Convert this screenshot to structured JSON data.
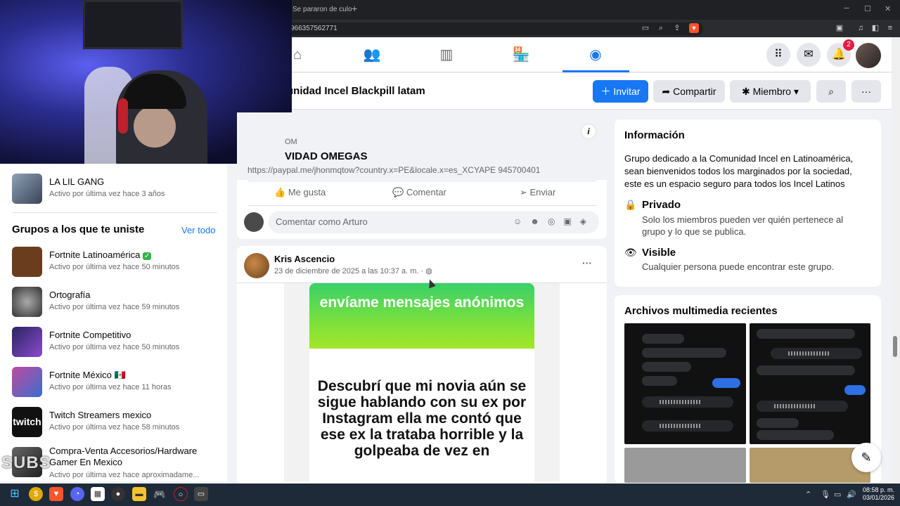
{
  "browser": {
    "tab_title": "Se pararon de culo",
    "new_tab": "+",
    "url_fragment": "966357562771",
    "window_controls": [
      "─",
      "☐",
      "✕"
    ]
  },
  "nav": {
    "notification_count": "2",
    "active_tab": "groups"
  },
  "group": {
    "title": "unidad Incel Blackpill latam",
    "invite_label": "Invitar",
    "share_label": "Compartir",
    "member_label": "Miembro"
  },
  "sidebar": {
    "top_item": {
      "name": "LA LIL GANG",
      "activity": "Activo por última vez hace 3 años"
    },
    "joined_title": "Grupos a los que te uniste",
    "see_all": "Ver todo",
    "groups": [
      {
        "name": "Fortnite Latinoamérica",
        "activity": "Activo por última vez hace 50 minutos",
        "color": "#6b3d1f"
      },
      {
        "name": "Ortografía",
        "activity": "Activo por última vez hace 59 minutos",
        "color": "#555555"
      },
      {
        "name": "Fortnite Competitivo",
        "activity": "Activo por última vez hace 50 minutos",
        "color": "#2a2460"
      },
      {
        "name": "Fortnite México 🇲🇽",
        "activity": "Activo por última vez hace 11 horas",
        "color": "#7a3b8f"
      },
      {
        "name": "Twitch Streamers mexico",
        "activity": "Activo por última vez hace 58 minutos",
        "color": "#111111"
      },
      {
        "name": "Compra-Venta Accesorios/Hardware Gamer En Mexico",
        "activity": "Activo por última vez hace aproximadame...",
        "color": "#333333"
      }
    ]
  },
  "feed": {
    "link_small": "OM",
    "link_title": "VIDAD OMEGAS",
    "link_url": "https://paypal.me/jhonmqtow?country.x=PE&locale.x=es_XCYAPE 945700401",
    "actions": {
      "like": "Me gusta",
      "comment": "Comentar",
      "send": "Enviar"
    },
    "comment_placeholder": "Comentar como Arturo",
    "post": {
      "author": "Kris Ascencio",
      "date": "23 de diciembre de 2025 a las 10:37 a. m. · ",
      "image_header": "envíame mensajes anónimos",
      "image_text": "Descubrí que mi novia aún se sigue hablando con su ex por Instagram ella me contó que ese ex la trataba horrible y la golpeaba de vez en"
    }
  },
  "about": {
    "title": "Información",
    "description": "Grupo dedicado a la Comunidad Incel en Latinoamérica, sean bienvenidos todos los marginados por la sociedad, este es un espacio seguro para todos los Incel Latinos",
    "privacy_title": "Privado",
    "privacy_desc": "Solo los miembros pueden ver quién pertenece al grupo y lo que se publica.",
    "visible_title": "Visible",
    "visible_desc": "Cualquier persona puede encontrar este grupo."
  },
  "media": {
    "title": "Archivos multimedia recientes"
  },
  "overlay": {
    "text": "SUBS"
  },
  "taskbar": {
    "time": "08:58 p. m.",
    "date": "03/01/2026"
  }
}
